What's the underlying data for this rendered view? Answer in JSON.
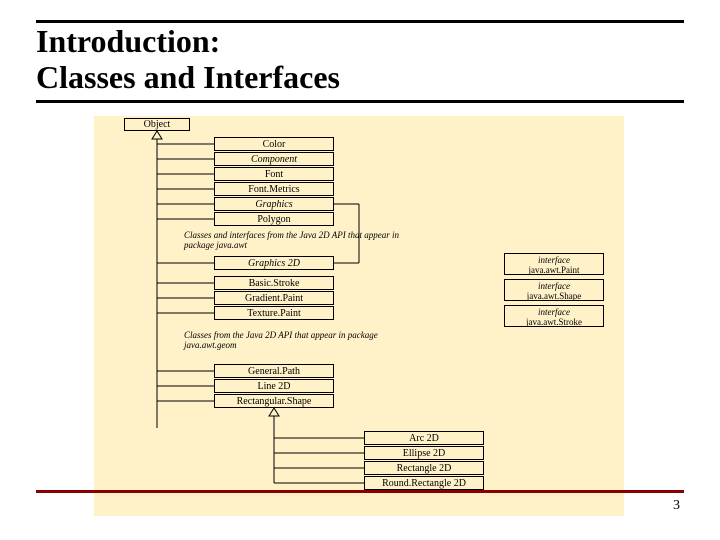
{
  "title_line1": "Introduction:",
  "title_line2": "Classes and Interfaces",
  "page_number": "3",
  "root": "Object",
  "awt_classes": [
    "Color",
    "Component",
    "Font",
    "Font.Metrics",
    "Graphics",
    "Polygon"
  ],
  "caption_awt": "Classes and interfaces from the Java 2D API that appear in package java.awt",
  "java2d_awt": [
    "Graphics 2D",
    "Basic.Stroke",
    "Gradient.Paint",
    "Texture.Paint"
  ],
  "interfaces": [
    {
      "tag": "interface",
      "name": "java.awt.Paint"
    },
    {
      "tag": "interface",
      "name": "java.awt.Shape"
    },
    {
      "tag": "interface",
      "name": "java.awt.Stroke"
    }
  ],
  "caption_geom": "Classes from the Java 2D API that appear in package java.awt.geom",
  "geom_classes": [
    "General.Path",
    "Line 2D",
    "Rectangular.Shape"
  ],
  "rect_subs": [
    "Arc 2D",
    "Ellipse 2D",
    "Rectangle 2D",
    "Round.Rectangle 2D"
  ]
}
